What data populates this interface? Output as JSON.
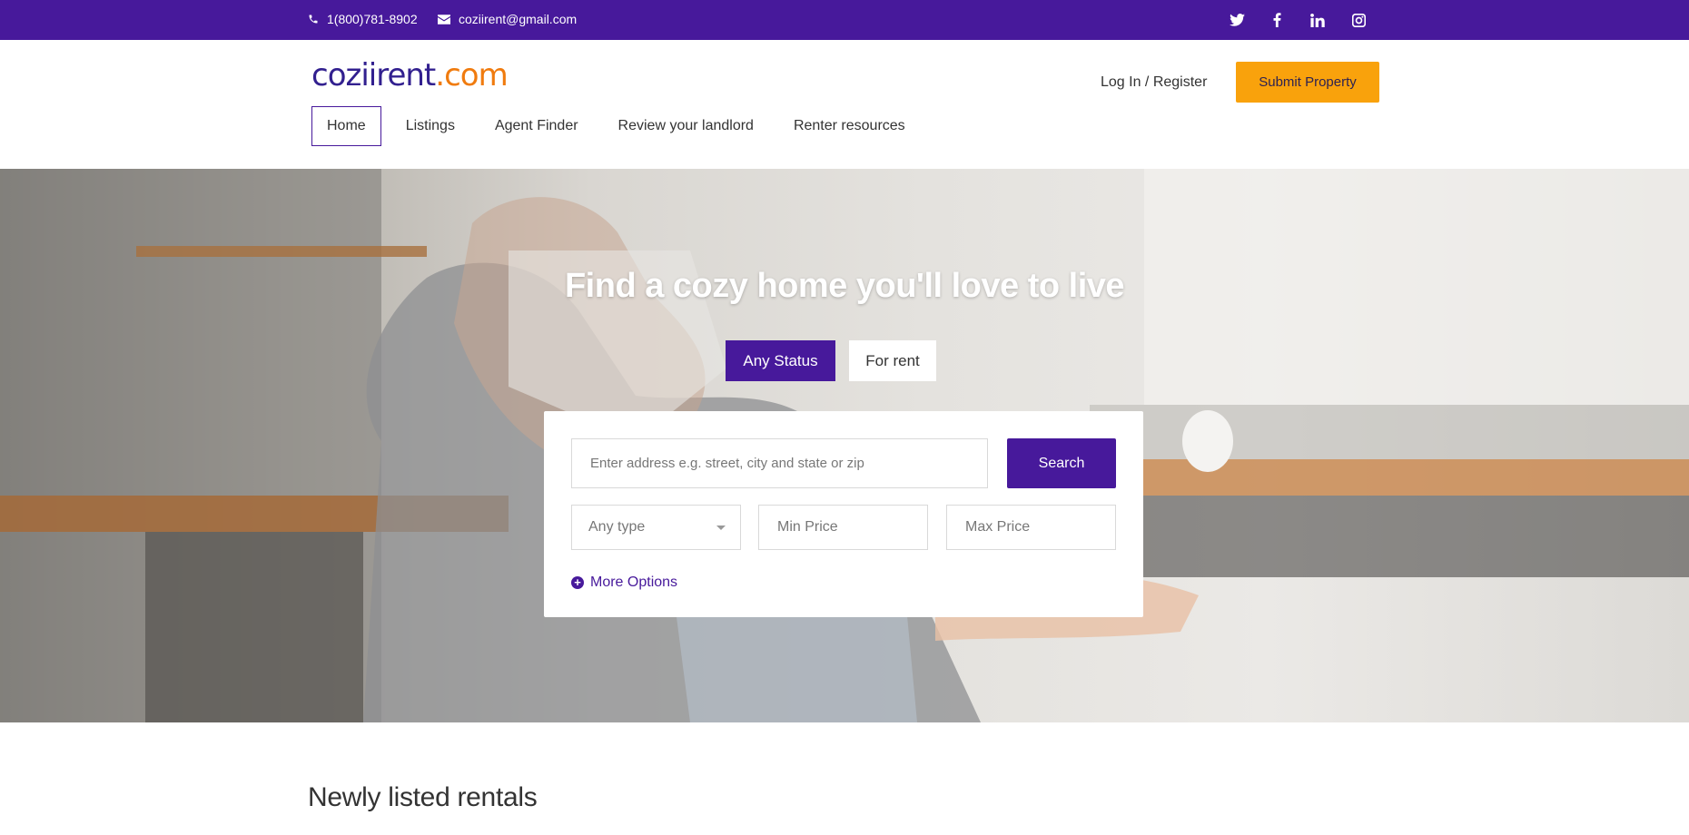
{
  "topbar": {
    "phone": "1(800)781-8902",
    "email": "coziirent@gmail.com",
    "social": [
      "twitter-icon",
      "facebook-icon",
      "linkedin-icon",
      "instagram-icon"
    ]
  },
  "header": {
    "logo_part1": "coziirent",
    "logo_part2": ".com",
    "login": "Log In",
    "auth_separator": " / ",
    "register": "Register",
    "submit_property": "Submit Property"
  },
  "nav": {
    "items": [
      {
        "label": "Home",
        "active": true
      },
      {
        "label": "Listings"
      },
      {
        "label": "Agent Finder"
      },
      {
        "label": "Review your landlord"
      },
      {
        "label": "Renter resources"
      }
    ]
  },
  "hero": {
    "title": "Find a cozy home you'll love to live",
    "status_tabs": [
      {
        "label": "Any Status",
        "active": true
      },
      {
        "label": "For rent"
      }
    ]
  },
  "search": {
    "address_placeholder": "Enter address e.g. street, city and state or zip",
    "search_label": "Search",
    "type_selected": "Any type",
    "min_price_placeholder": "Min Price",
    "max_price_placeholder": "Max Price",
    "more_options": "More Options"
  },
  "sections": {
    "newly_listed": "Newly listed rentals"
  },
  "colors": {
    "brand_purple": "#47199b",
    "accent_orange": "#f9a20c",
    "logo_blue": "#32208f",
    "logo_orange": "#f07b0e"
  }
}
